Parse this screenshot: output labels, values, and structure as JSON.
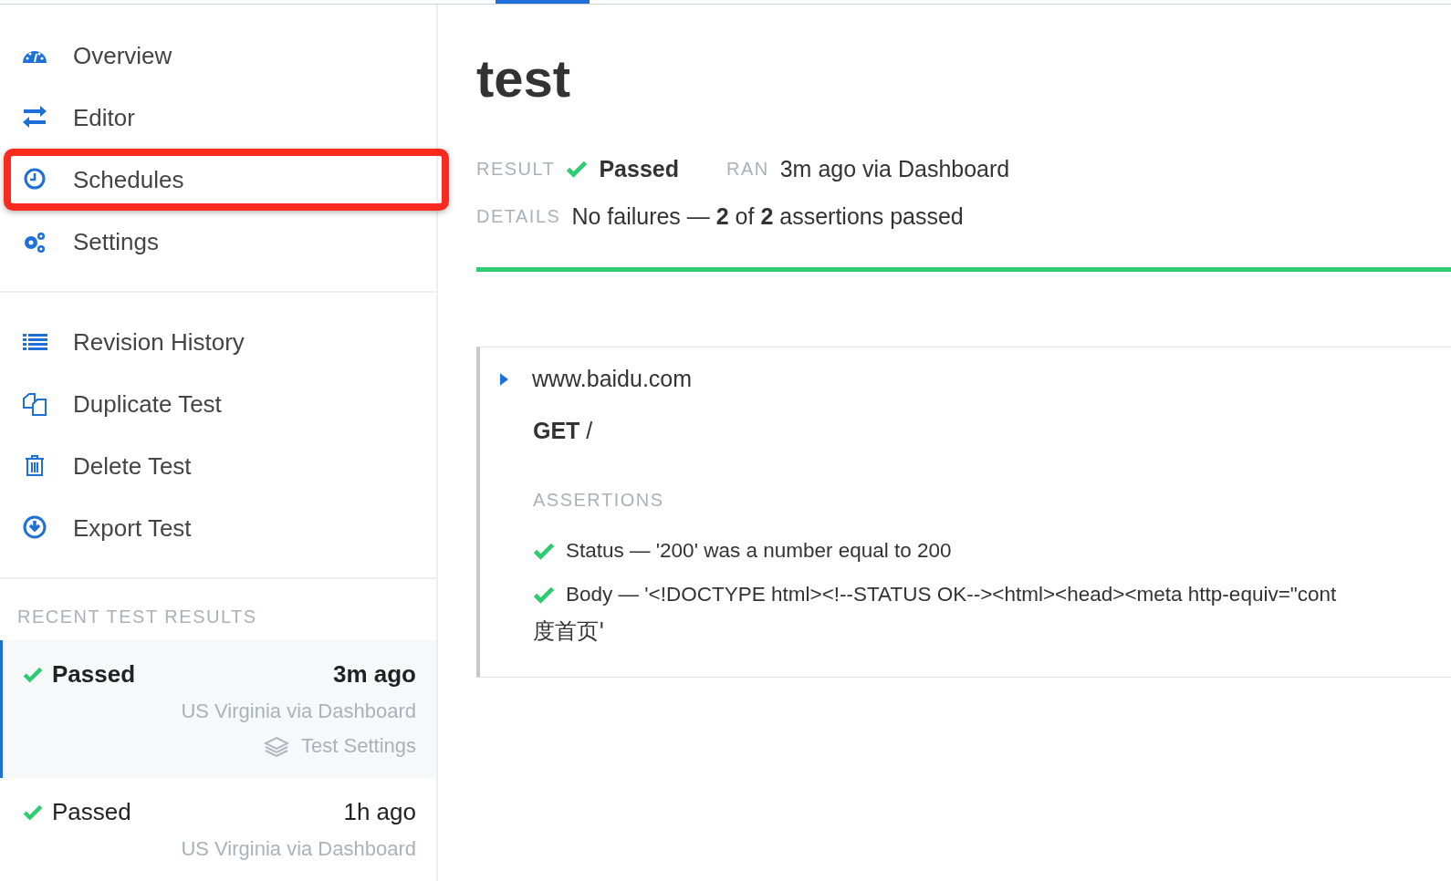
{
  "nav": [
    {
      "label": "Overview",
      "kind": "dashboard",
      "highlighted": false
    },
    {
      "label": "Editor",
      "kind": "arrows",
      "highlighted": false
    },
    {
      "label": "Schedules",
      "kind": "clock",
      "highlighted": true
    },
    {
      "label": "Settings",
      "kind": "gears",
      "highlighted": false
    }
  ],
  "actions": [
    {
      "label": "Revision History",
      "kind": "list"
    },
    {
      "label": "Duplicate Test",
      "kind": "copy"
    },
    {
      "label": "Delete Test",
      "kind": "trash"
    },
    {
      "label": "Export Test",
      "kind": "download"
    }
  ],
  "recent": {
    "heading": "RECENT TEST RESULTS",
    "items": [
      {
        "status": "Passed",
        "time": "3m ago",
        "location": "US Virginia via Dashboard",
        "settings_link": "Test Settings",
        "selected": true
      },
      {
        "status": "Passed",
        "time": "1h ago",
        "location": "US Virginia via Dashboard",
        "selected": false
      }
    ]
  },
  "test": {
    "title": "test",
    "result_label": "RESULT",
    "result": "Passed",
    "passed": true,
    "ran_label": "RAN",
    "ran": "3m ago via Dashboard",
    "details_label": "DETAILS",
    "details": "No failures — **2** of **2** assertions passed"
  },
  "request": {
    "host": "www.baidu.com",
    "method": "GET",
    "path": "/",
    "assertions_heading": "ASSERTIONS",
    "assertions": [
      {
        "text": "Status — '200' was a number equal to 200",
        "passed": true
      },
      {
        "text": "Body — '<!DOCTYPE html><!--STATUS OK--><html><head><meta http-equiv=\"cont",
        "continuation": "度首页'",
        "passed": true
      }
    ]
  }
}
